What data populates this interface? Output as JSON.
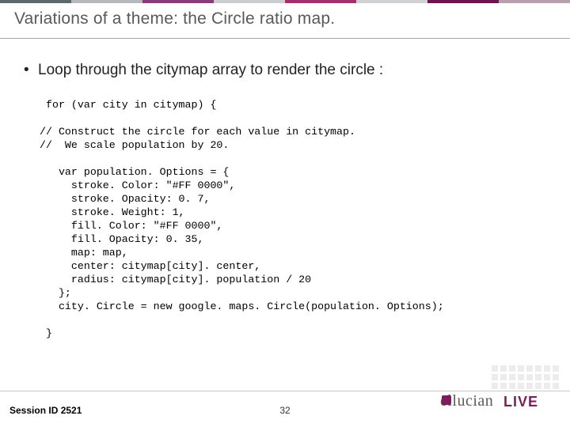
{
  "title": "Variations of a theme: the Circle ratio map.",
  "bullet": "Loop through the citymap array to render the circle :",
  "code": " for (var city in citymap) {\n\n// Construct the circle for each value in citymap.\n//  We scale population by 20.\n\n   var population. Options = {\n     stroke. Color: \"#FF 0000\",\n     stroke. Opacity: 0. 7,\n     stroke. Weight: 1,\n     fill. Color: \"#FF 0000\",\n     fill. Opacity: 0. 35,\n     map: map,\n     center: citymap[city]. center,\n     radius: citymap[city]. population / 20\n   };\n   city. Circle = new google. maps. Circle(population. Options);\n\n }",
  "footer": {
    "session": "Session ID 2521",
    "page": "32"
  },
  "logo": {
    "brand": "ellucian",
    "suffix": "LIVE"
  }
}
